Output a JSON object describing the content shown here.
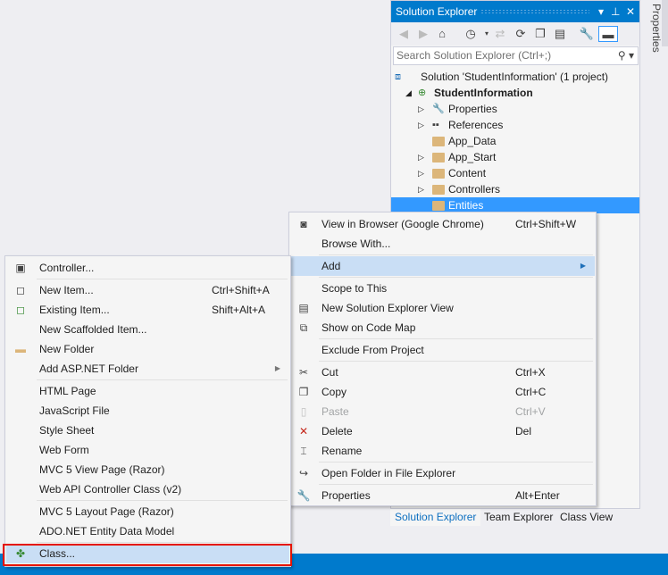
{
  "solution_explorer": {
    "title": "Solution Explorer",
    "search_placeholder": "Search Solution Explorer (Ctrl+;)",
    "tree": [
      {
        "label": "Solution 'StudentInformation' (1 project)",
        "icon": "solution-icon",
        "level": 0,
        "expander": "none"
      },
      {
        "label": "StudentInformation",
        "icon": "web-project-icon",
        "level": 1,
        "expander": "expanded",
        "bold": true
      },
      {
        "label": "Properties",
        "icon": "wrench-icon",
        "level": 2,
        "expander": "collapsed"
      },
      {
        "label": "References",
        "icon": "references-icon",
        "level": 2,
        "expander": "collapsed"
      },
      {
        "label": "App_Data",
        "icon": "folder-icon",
        "level": 2,
        "expander": "none"
      },
      {
        "label": "App_Start",
        "icon": "folder-icon",
        "level": 2,
        "expander": "collapsed"
      },
      {
        "label": "Content",
        "icon": "folder-icon",
        "level": 2,
        "expander": "collapsed"
      },
      {
        "label": "Controllers",
        "icon": "folder-icon",
        "level": 2,
        "expander": "collapsed"
      },
      {
        "label": "Entities",
        "icon": "folder-icon",
        "level": 2,
        "expander": "none",
        "selected": true
      }
    ],
    "bottom_tabs": [
      {
        "label": "Solution Explorer",
        "active": true
      },
      {
        "label": "Team Explorer",
        "active": false
      },
      {
        "label": "Class View",
        "active": false
      }
    ]
  },
  "properties_tab": "Properties",
  "context_menu": [
    {
      "label": "View in Browser (Google Chrome)",
      "shortcut": "Ctrl+Shift+W",
      "icon": "browser-icon",
      "glyph": "◙"
    },
    {
      "label": "Browse With...",
      "shortcut": ""
    },
    {
      "sep": true
    },
    {
      "label": "Add",
      "submenu": true,
      "highlighted": true
    },
    {
      "sep": true
    },
    {
      "label": "Scope to This"
    },
    {
      "label": "New Solution Explorer View",
      "icon": "new-view-icon",
      "glyph": "▤"
    },
    {
      "label": "Show on Code Map",
      "icon": "code-map-icon",
      "glyph": "⧉"
    },
    {
      "sep": true
    },
    {
      "label": "Exclude From Project"
    },
    {
      "sep": true
    },
    {
      "label": "Cut",
      "shortcut": "Ctrl+X",
      "icon": "scissors-icon",
      "glyph": "✂"
    },
    {
      "label": "Copy",
      "shortcut": "Ctrl+C",
      "icon": "copy-icon",
      "glyph": "❐"
    },
    {
      "label": "Paste",
      "shortcut": "Ctrl+V",
      "icon": "paste-icon",
      "glyph": "▯",
      "disabled": true
    },
    {
      "label": "Delete",
      "shortcut": "Del",
      "icon": "delete-icon",
      "glyph": "✕",
      "color": "#C5281C"
    },
    {
      "label": "Rename",
      "icon": "rename-icon",
      "glyph": "⌶"
    },
    {
      "sep": true
    },
    {
      "label": "Open Folder in File Explorer",
      "icon": "open-folder-icon",
      "glyph": "↪"
    },
    {
      "sep": true
    },
    {
      "label": "Properties",
      "shortcut": "Alt+Enter",
      "icon": "wrench-icon",
      "glyph": "🔧"
    }
  ],
  "add_submenu": [
    {
      "label": "Controller...",
      "icon": "controller-icon",
      "glyph": "▣"
    },
    {
      "sep": true
    },
    {
      "label": "New Item...",
      "shortcut": "Ctrl+Shift+A",
      "icon": "new-item-icon",
      "glyph": "◻"
    },
    {
      "label": "Existing Item...",
      "shortcut": "Shift+Alt+A",
      "icon": "existing-item-icon",
      "glyph": "◻",
      "color": "#388A34"
    },
    {
      "label": "New Scaffolded Item..."
    },
    {
      "label": "New Folder",
      "icon": "new-folder-icon",
      "glyph": "▬",
      "color": "#DCB67A"
    },
    {
      "label": "Add ASP.NET Folder",
      "submenu": true
    },
    {
      "sep": true
    },
    {
      "label": "HTML Page"
    },
    {
      "label": "JavaScript File"
    },
    {
      "label": "Style Sheet"
    },
    {
      "label": "Web Form"
    },
    {
      "label": "MVC 5 View Page (Razor)"
    },
    {
      "label": "Web API Controller Class (v2)"
    },
    {
      "sep": true
    },
    {
      "label": "MVC 5 Layout Page (Razor)"
    },
    {
      "label": "ADO.NET Entity Data Model"
    },
    {
      "sep": true
    },
    {
      "label": "Class...",
      "icon": "class-icon",
      "glyph": "✤",
      "color": "#388A34",
      "highlighted": true
    }
  ],
  "colors": {
    "accent": "#007ACC",
    "selection": "#3399FF",
    "menu_highlight": "#C9DEF5",
    "callout": "#E51400"
  }
}
